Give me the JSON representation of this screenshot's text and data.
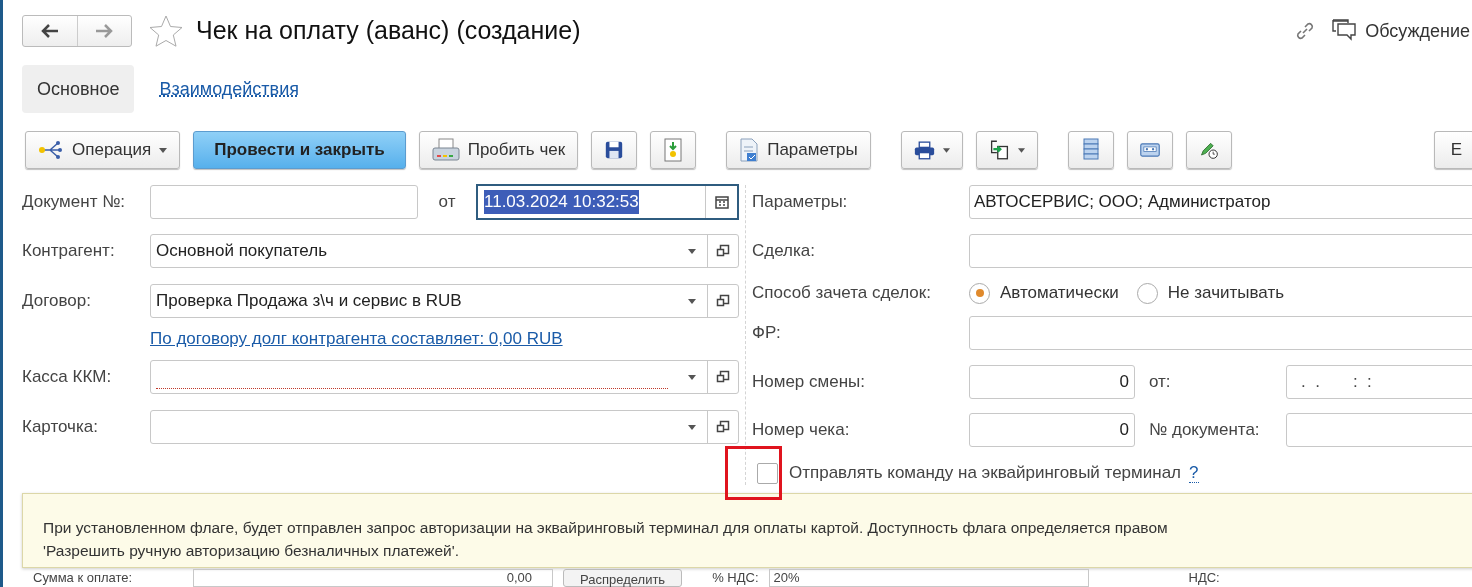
{
  "title": "Чек на оплату (аванс) (создание)",
  "header_actions": [
    {
      "label": "Обсуждение"
    }
  ],
  "tabs": [
    {
      "label": "Основное",
      "selected": true
    },
    {
      "label": "Взаимодействия",
      "selected": false
    }
  ],
  "toolbar": [
    [
      {
        "kind": "menu",
        "label": "Операция"
      },
      {
        "kind": "primary",
        "label": "Провести и закрыть"
      },
      {
        "kind": "button",
        "label": "Пробить чек"
      },
      {
        "kind": "icon"
      },
      {
        "kind": "icon"
      }
    ],
    [
      {
        "kind": "button",
        "label": "Параметры"
      }
    ],
    [
      {
        "kind": "icon-menu"
      },
      {
        "kind": "icon-menu"
      }
    ],
    [
      {
        "kind": "icon"
      },
      {
        "kind": "icon"
      },
      {
        "kind": "icon"
      }
    ],
    [
      {
        "kind": "button",
        "label": "Е"
      }
    ]
  ],
  "left_fields": [
    {
      "kind": "number_date",
      "label": "Документ №:",
      "between": "от",
      "date": "11.03.2024 10:32:53"
    },
    {
      "kind": "select",
      "label": "Контрагент:",
      "value": "Основной покупатель",
      "required": false
    },
    {
      "kind": "select",
      "label": "Договор:",
      "value": "Проверка Продажа з\\ч и сервис в RUB",
      "required": false
    },
    {
      "kind": "link",
      "text": "По договору долг контрагента составляет: 0,00 RUB"
    },
    {
      "kind": "select",
      "label": "Касса ККМ:",
      "required": true
    },
    {
      "kind": "select",
      "label": "Карточка:",
      "required": false
    }
  ],
  "right_fields": [
    {
      "kind": "text",
      "label": "Параметры:",
      "value": "АВТОСЕРВИС; ООО; Администратор"
    },
    {
      "kind": "text",
      "label": "Сделка:"
    },
    {
      "kind": "radio",
      "label": "Способ зачета сделок:",
      "options": [
        {
          "label": "Автоматически",
          "selected": true
        },
        {
          "label": "Не зачитывать",
          "selected": false
        }
      ]
    },
    {
      "kind": "text",
      "label": "ФР:"
    },
    {
      "kind": "pair",
      "label": "Номер смены:",
      "value": "0",
      "second_label": "от:",
      "second_value": ".  .       :  :"
    },
    {
      "kind": "pair",
      "label": "Номер чека:",
      "value": "0",
      "second_label": "№ документа:"
    },
    {
      "kind": "checkbox",
      "label": "Отправлять команду на эквайринговый терминал",
      "checked": false,
      "help": "?"
    }
  ],
  "tooltip": {
    "lines": [
      "При установленном флаге, будет отправлен запрос авторизации на эквайринговый терминал для оплаты картой. Доступность флага определяется правом",
      "'Разрешить ручную авторизацию безналичных платежей'."
    ]
  },
  "totals": {
    "sum_label": "Сумма к оплате:",
    "sum_value": "0,00",
    "distribute": "Распределить",
    "vat_rate_label": "% НДС:",
    "vat_rate": "20%",
    "vat_label": "НДС:"
  }
}
